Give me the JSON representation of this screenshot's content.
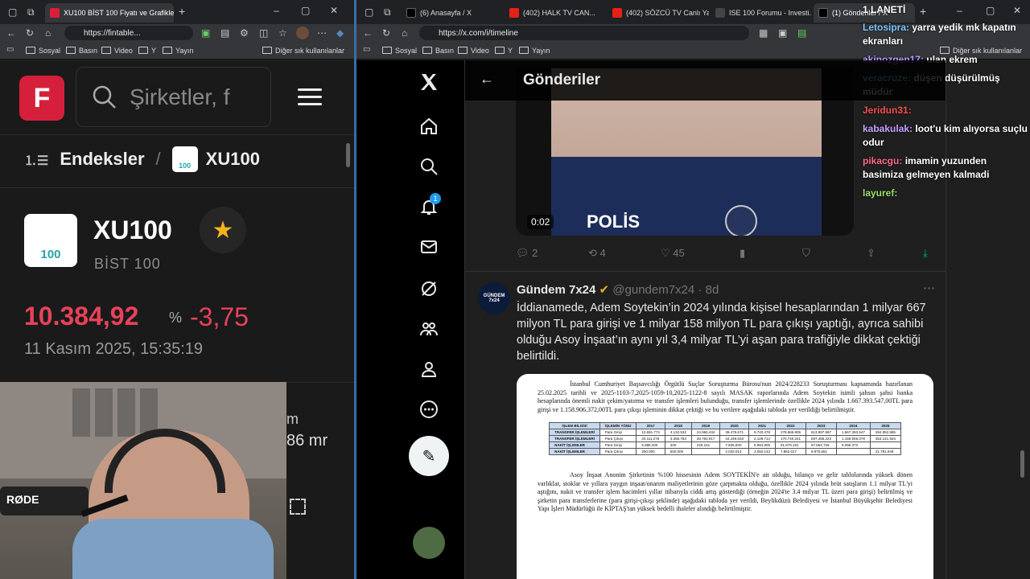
{
  "left_browser": {
    "tab_title": "XU100 BİST 100 Fiyatı ve Grafikle...",
    "url": "https://fintable...",
    "bookmarks": [
      "Sosyal",
      "Basın",
      "Video",
      "Y",
      "Yayın"
    ],
    "bookmarks_other": "Diğer sık kullanılanlar"
  },
  "finance": {
    "logo_letter": "F",
    "search_placeholder": "Şirketler, f",
    "breadcrumb_root": "Endeksler",
    "breadcrumb_separator": "/",
    "breadcrumb_current": "XU100",
    "logo_number": "100",
    "symbol": "XU100",
    "name": "BİST 100",
    "price": "10.384,92",
    "change_prefix": "%",
    "change": "-3,75",
    "datetime": "11 Kasım 2025, 15:35:19",
    "partial_value_1": "m",
    "partial_value_2": "86 mr"
  },
  "right_browser": {
    "tabs": [
      "(6) Anasayfa / X",
      "(402) HALK TV CAN...",
      "(402) SÖZCÜ TV Canlı Ya...",
      "ISE 100 Forumu - Investi...",
      "(1) Gönderiler / X"
    ],
    "url": "https://x.com/i/timeline",
    "bookmarks": [
      "Sosyal",
      "Basın",
      "Video",
      "Y",
      "Yayın"
    ],
    "bookmarks_other": "Diğer sık kullanılanlar",
    "notification_count": "1"
  },
  "timeline": {
    "header": "Gönderiler",
    "video_time": "0:02",
    "video_label": "POLİS",
    "stats": {
      "replies": "2",
      "reposts": "4",
      "likes": "45"
    },
    "tweet": {
      "author": "Gündem 7x24",
      "handle": "@gundem7x24",
      "time": "· 8d",
      "avatar_text": "GÜNDEM 7x24",
      "text": "İddianamede, Adem Soytekin’in 2024 yılında kişisel hesaplarından 1 milyar 667 milyon TL para girişi ve 1 milyar 158 milyon TL para çıkışı yaptığı, ayrıca sahibi olduğu Asoy İnşaat’ın aynı yıl 3,4 milyar TL’yi aşan para trafiğiyle dikkat çektiği belirtildi."
    },
    "document": {
      "para1": "İstanbul Cumhuriyet Başsavcılığı Örgütlü Suçlar Soruşturma Bürosu'nun 2024/228233 Soruşturması kapsamında hazırlanan 25.02.2025 tarihli ve 2025-1103-7,2025-1059-10,2025-1122-8 sayılı MASAK raporlarında Adem Soytekin isimli şahsın şahsi banka hesaplarında önemli nakit çekim/yatırma ve transfer işlemleri bulunduğu, transfer işlemlerinde özellikle 2024 yılında 1.667.393.547,00TL para girişi ve 1.158.906.372,00TL para çıkışı işleminin dikkat çektiği ve bu verilere aşağıdaki tabloda yer verildiği belirtilmiştir.",
      "table_header": [
        "İŞLEM BİLGİSİ",
        "İŞLEMİN YÖNÜ",
        "2017",
        "2018",
        "2019",
        "2020",
        "2021",
        "2022",
        "2023",
        "2024",
        "2025"
      ],
      "table_rows": [
        [
          "TRANSFER İŞLEMLERİ",
          "Para Girişi",
          "12.691.774",
          "4.132.532",
          "24.965.434",
          "39.475.671",
          "9.740.478",
          "278.565.805",
          "613.897.997",
          "1.667.393.547",
          "284.852.585"
        ],
        [
          "TRANSFER İŞLEMLERİ",
          "Para Çıkışı",
          "20.111.278",
          "3.356.753",
          "28.784.917",
          "44.449.833",
          "2.128.714",
          "170.740.241",
          "597.486.223",
          "1.158.906.078",
          "353.121.923"
        ],
        [
          "NAKİT İŞLEMLER",
          "Para Girişi",
          "6.986.200",
          "400",
          "226.161",
          "7.835.830",
          "6.984.905",
          "91.679.191",
          "97.664.726",
          "9.095.372",
          ""
        ],
        [
          "NAKİT İŞLEMLER",
          "Para Çıkışı",
          "250.000",
          "500.000",
          "",
          "2.033.014",
          "2.082.143",
          "7.862.017",
          "9.875.661",
          "",
          "21.781.949"
        ]
      ],
      "para2": "Asoy İnşaat Anonim Şirketinin %100 hissesinin Adem SOYTEKİN'e ait olduğu, bilanço ve gelir tablolarında yüksek dönen varlıklar, stoklar ve yıllara yaygın inşaat/onarım maliyetlerinin göze çarpmakta olduğu, özellikle 2024 yılında brüt satışların 1.1 milyar TL'yi aştığını, nakit ve transfer işlem hacimleri yıllar itibarıyla ciddi artış gösterdiği (örneğin 2024'te 3.4 milyar TL üzeri para girişi) belirtilmiş ve şirketin para transferlerine (para girişi-çıkışı şeklinde) aşağıdaki tabloda yer verildi, Beylikdüzü Belediyesi ve İstanbul Büyükşehir Belediyesi Yapı İşleri Müdürlüğü ile KİPTAŞ'tan yüksek bedelli ihaleler alındığı belirtilmiştir."
    }
  },
  "chat_overlay": {
    "title": "1 LANETİ",
    "messages": [
      {
        "user": "Letosipra:",
        "user_color": "#7ec8ff",
        "text": "yarra yedik mk kapatın ekranları"
      },
      {
        "user": "akinozgen17:",
        "user_color": "#b39cff",
        "text": "ulan ekrem"
      },
      {
        "user": "veracruze:",
        "user_color": "#7ec8ff",
        "text": "düşen düşürülmüş müdür"
      },
      {
        "user": "Jeridun31:",
        "user_color": "#ff4d4d",
        "text": ""
      },
      {
        "user": "kabakulak:",
        "user_color": "#c8a2ff",
        "text": "loot'u kim alıyorsa suçlu odur"
      },
      {
        "user": "pikacgu:",
        "user_color": "#ff6b8a",
        "text": "imamin yuzunden basimiza gelmeyen kalmadi"
      },
      {
        "user": "layuref:",
        "user_color": "#9be36b",
        "text": ""
      }
    ]
  },
  "webcam": {
    "mic_brand": "RØDE"
  }
}
